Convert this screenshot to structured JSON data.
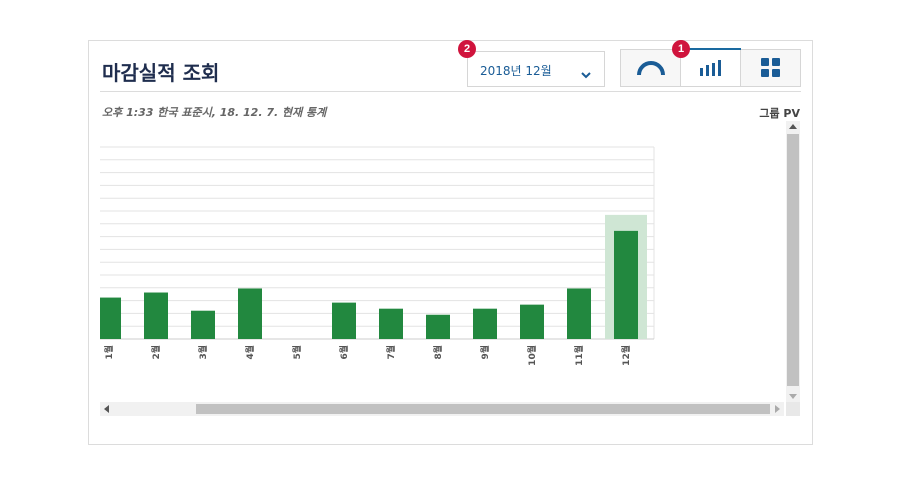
{
  "panel": {
    "title": "마감실적 조회",
    "date_select": {
      "value": "2018년 12월"
    },
    "badges": {
      "view_toggle": "1",
      "date_select": "2"
    },
    "view_buttons": [
      {
        "name": "gauge-view",
        "icon": "gauge-icon",
        "active": false
      },
      {
        "name": "bar-view",
        "icon": "bar-chart-icon",
        "active": true
      },
      {
        "name": "grid-view",
        "icon": "grid-icon",
        "active": false
      }
    ],
    "timestamp": "오후 1:33 한국 표준시, 18. 12. 7. 현재 통계",
    "group_label": "그룹 PV"
  },
  "colors": {
    "bar": "#22883f",
    "highlight": "#cfe6d4",
    "accent": "#1a6aa0",
    "badge": "#d0143d"
  },
  "chart_data": {
    "type": "bar",
    "categories": [
      "1월",
      "2월",
      "3월",
      "4월",
      "5월",
      "6월",
      "7월",
      "8월",
      "9월",
      "10월",
      "11월",
      "12월"
    ],
    "values": [
      41,
      46,
      28,
      50,
      0,
      36,
      30,
      24,
      30,
      34,
      50,
      107
    ],
    "highlight_category": "12월",
    "ylim": [
      0,
      190
    ],
    "grid": true,
    "title": "",
    "xlabel": "",
    "ylabel": ""
  }
}
